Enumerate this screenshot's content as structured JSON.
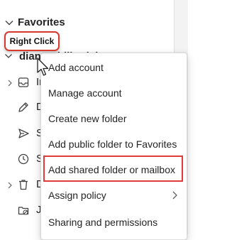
{
  "nav": {
    "favorites_label": "Favorites",
    "account_label": "diane@billerdale",
    "folders": [
      {
        "label": "In",
        "icon": "inbox-icon",
        "has_chevron": true
      },
      {
        "label": "D",
        "icon": "drafts-icon",
        "has_chevron": false
      },
      {
        "label": "S",
        "icon": "sent-icon",
        "has_chevron": false
      },
      {
        "label": "S",
        "icon": "scheduled-icon",
        "has_chevron": false
      },
      {
        "label": "D",
        "icon": "deleted-icon",
        "has_chevron": true
      },
      {
        "label": "Ju",
        "icon": "junk-icon",
        "has_chevron": false
      }
    ]
  },
  "callout": {
    "text": "Right Click"
  },
  "context_menu": {
    "items": [
      {
        "label": "Add account"
      },
      {
        "label": "Manage account"
      },
      {
        "label": "Create new folder"
      },
      {
        "label": "Add public folder to Favorites"
      },
      {
        "label": "Add shared folder or mailbox"
      },
      {
        "label": "Assign policy"
      },
      {
        "label": "Sharing and permissions"
      }
    ],
    "highlight_color": "#e03a3a"
  }
}
